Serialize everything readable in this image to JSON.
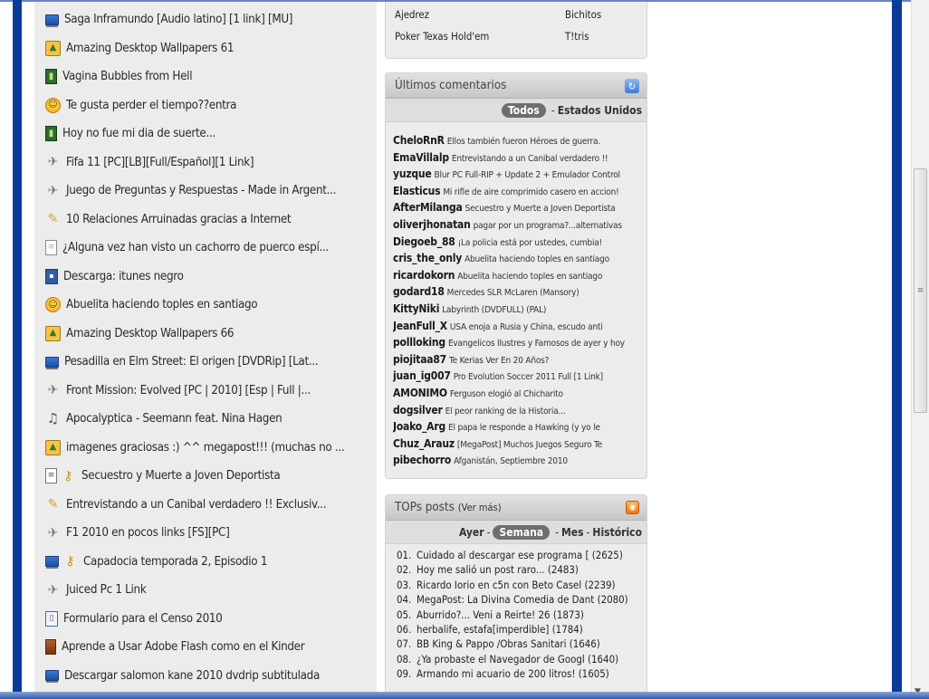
{
  "posts": [
    {
      "icon": "pc",
      "title": "Saga Inframundo [Audio latino] [1 link] [MU]"
    },
    {
      "icon": "img",
      "title": "Amazing Desktop Wallpapers 61"
    },
    {
      "icon": "film",
      "title": "Vagina Bubbles from Hell"
    },
    {
      "icon": "smile",
      "title": "Te gusta perder el tiempo??entra"
    },
    {
      "icon": "film",
      "title": "Hoy no fue mi dia de suerte..."
    },
    {
      "icon": "game",
      "title": "Fifa 11 [PC][LB][Full/Español][1 Link]"
    },
    {
      "icon": "game",
      "title": "Juego de Preguntas y Respuestas - Made in Argent..."
    },
    {
      "icon": "idea",
      "title": "10 Relaciones Arruinadas gracias a Internet"
    },
    {
      "icon": "doc",
      "title": "¿Alguna vez han visto un cachorro de puerco espí..."
    },
    {
      "icon": "floppy",
      "title": "Descarga: itunes negro"
    },
    {
      "icon": "smile",
      "title": "Abuelita haciendo toples en santiago"
    },
    {
      "icon": "img",
      "title": "Amazing Desktop Wallpapers 66"
    },
    {
      "icon": "pc",
      "title": "Pesadilla en Elm Street: El origen [DVDRip] [Lat..."
    },
    {
      "icon": "game",
      "title": "Front Mission: Evolved [PC | 2010] [Esp | Full |..."
    },
    {
      "icon": "music",
      "title": "Apocalyptica - Seemann feat. Nina Hagen"
    },
    {
      "icon": "img",
      "title": "imagenes graciosas :) ^^ megapost!!! (muchas no ..."
    },
    {
      "icon": "news",
      "icon2": "key",
      "title": "Secuestro y Muerte a Joven Deportista"
    },
    {
      "icon": "idea",
      "title": "Entrevistando a un Canibal verdadero !! Exclusiv..."
    },
    {
      "icon": "game",
      "title": "F1 2010 en pocos links [FS][PC]"
    },
    {
      "icon": "pc",
      "icon2": "key",
      "title": "Capadocia temporada 2, Episodio 1"
    },
    {
      "icon": "game",
      "title": "Juiced Pc 1 Link"
    },
    {
      "icon": "book",
      "title": "Formulario para el Censo 2010"
    },
    {
      "icon": "brown",
      "title": "Aprende a Usar Adobe Flash como en el Kinder"
    },
    {
      "icon": "pc",
      "title": "Descargar salomon kane 2010 dvdrip subtitulada"
    }
  ],
  "games": {
    "items": [
      "Ajedrez",
      "Bichitos",
      "Poker Texas Hold'em",
      "T!tris"
    ]
  },
  "comments": {
    "title": "Últimos comentarios",
    "filter_all": "Todos",
    "filter_separator": "-",
    "filter_country": "Estados Unidos",
    "items": [
      {
        "user": "CheloRnR",
        "text": "Ellos también fueron Héroes de guerra."
      },
      {
        "user": "EmaVillalp",
        "text": "Entrevistando a un Canibal verdadero !!"
      },
      {
        "user": "yuzque",
        "text": "Blur PC Full-RIP + Update 2 + Emulador Control"
      },
      {
        "user": "Elasticus",
        "text": "Mi rifle de aire comprimido casero en accion!"
      },
      {
        "user": "AfterMilanga",
        "text": "Secuestro y Muerte a Joven Deportista"
      },
      {
        "user": "oliverjhonatan",
        "text": "pagar por un programa?...alternativas"
      },
      {
        "user": "Diegoeb_88",
        "text": "¡La policia está por ustedes, cumbia!"
      },
      {
        "user": "cris_the_only",
        "text": "Abuelita haciendo toples en santiago"
      },
      {
        "user": "ricardokorn",
        "text": "Abuelita haciendo toples en santiago"
      },
      {
        "user": "godard18",
        "text": "Mercedes SLR McLaren (Mansory)"
      },
      {
        "user": "KittyNiki",
        "text": "Labyrinth (DVDFULL) (PAL)"
      },
      {
        "user": "JeanFull_X",
        "text": "USA enoja a Rusia y China, escudo anti"
      },
      {
        "user": "pollloking",
        "text": "Evangelicos Ilustres y Famosos de ayer y hoy"
      },
      {
        "user": "piojitaa87",
        "text": "Te Kerias Ver En 20 Años?"
      },
      {
        "user": "juan_ig007",
        "text": "Pro Evolution Soccer 2011 Full [1 Link]"
      },
      {
        "user": "AMONIMO",
        "text": "Ferguson elogió al Chicharito"
      },
      {
        "user": "dogsilver",
        "text": "El peor ranking de la Historia..."
      },
      {
        "user": "Joako_Arg",
        "text": "El papa le responde a Hawking (y yo le"
      },
      {
        "user": "Chuz_Arauz",
        "text": "[MegaPost] Muchos Juegos Seguro Te"
      },
      {
        "user": "pibechorro",
        "text": "Afganistán, Septiembre 2010"
      }
    ]
  },
  "tops": {
    "title": "TOPs posts",
    "more": "(Ver más)",
    "filter_ayer": "Ayer",
    "filter_semana": "Semana",
    "filter_mes": "Mes",
    "filter_historico": "Histórico",
    "filter_separator": "-",
    "items": [
      {
        "num": "01.",
        "title": "Cuidado al descargar ese programa [",
        "count": "(2625)"
      },
      {
        "num": "02.",
        "title": "Hoy me salió un post raro...",
        "count": "(2483)"
      },
      {
        "num": "03.",
        "title": "Ricardo Iorio en c5n con Beto Casel",
        "count": "(2239)"
      },
      {
        "num": "04.",
        "title": "MegaPost: La Divina Comedia de Dant",
        "count": "(2080)"
      },
      {
        "num": "05.",
        "title": "Aburrido?... Veni a Reirte! 26",
        "count": "(1873)"
      },
      {
        "num": "06.",
        "title": "herbalife, estafa[imperdible]",
        "count": "(1784)"
      },
      {
        "num": "07.",
        "title": "BB King & Pappo /Obras Sanitari",
        "count": "(1646)"
      },
      {
        "num": "08.",
        "title": "¿Ya probaste el Navegador de Googl",
        "count": "(1640)"
      },
      {
        "num": "09.",
        "title": "Armando mi acuario de 200 litros!",
        "count": "(1605)"
      }
    ]
  },
  "icon_glyphs": {
    "pc": "",
    "img": "▲",
    "film": "▮",
    "smile": "☺",
    "game": "✈",
    "idea": "✎",
    "doc": "≡",
    "floppy": "▪",
    "music": "♫",
    "news": "≡",
    "key": "⚷",
    "book": "▯",
    "brown": ""
  },
  "icon_names": {
    "pc": "monitor-icon",
    "img": "image-icon",
    "film": "film-icon",
    "smile": "smiley-icon",
    "game": "game-icon",
    "idea": "lightbulb-icon",
    "doc": "document-icon",
    "floppy": "floppy-icon",
    "music": "music-note-icon",
    "news": "newspaper-icon",
    "key": "key-icon",
    "book": "book-icon",
    "brown": "category-icon"
  },
  "colors": {
    "frame_blue": "#0b3b9a",
    "panel_bg": "#ececec",
    "pill_bg": "#6e6e6e"
  }
}
